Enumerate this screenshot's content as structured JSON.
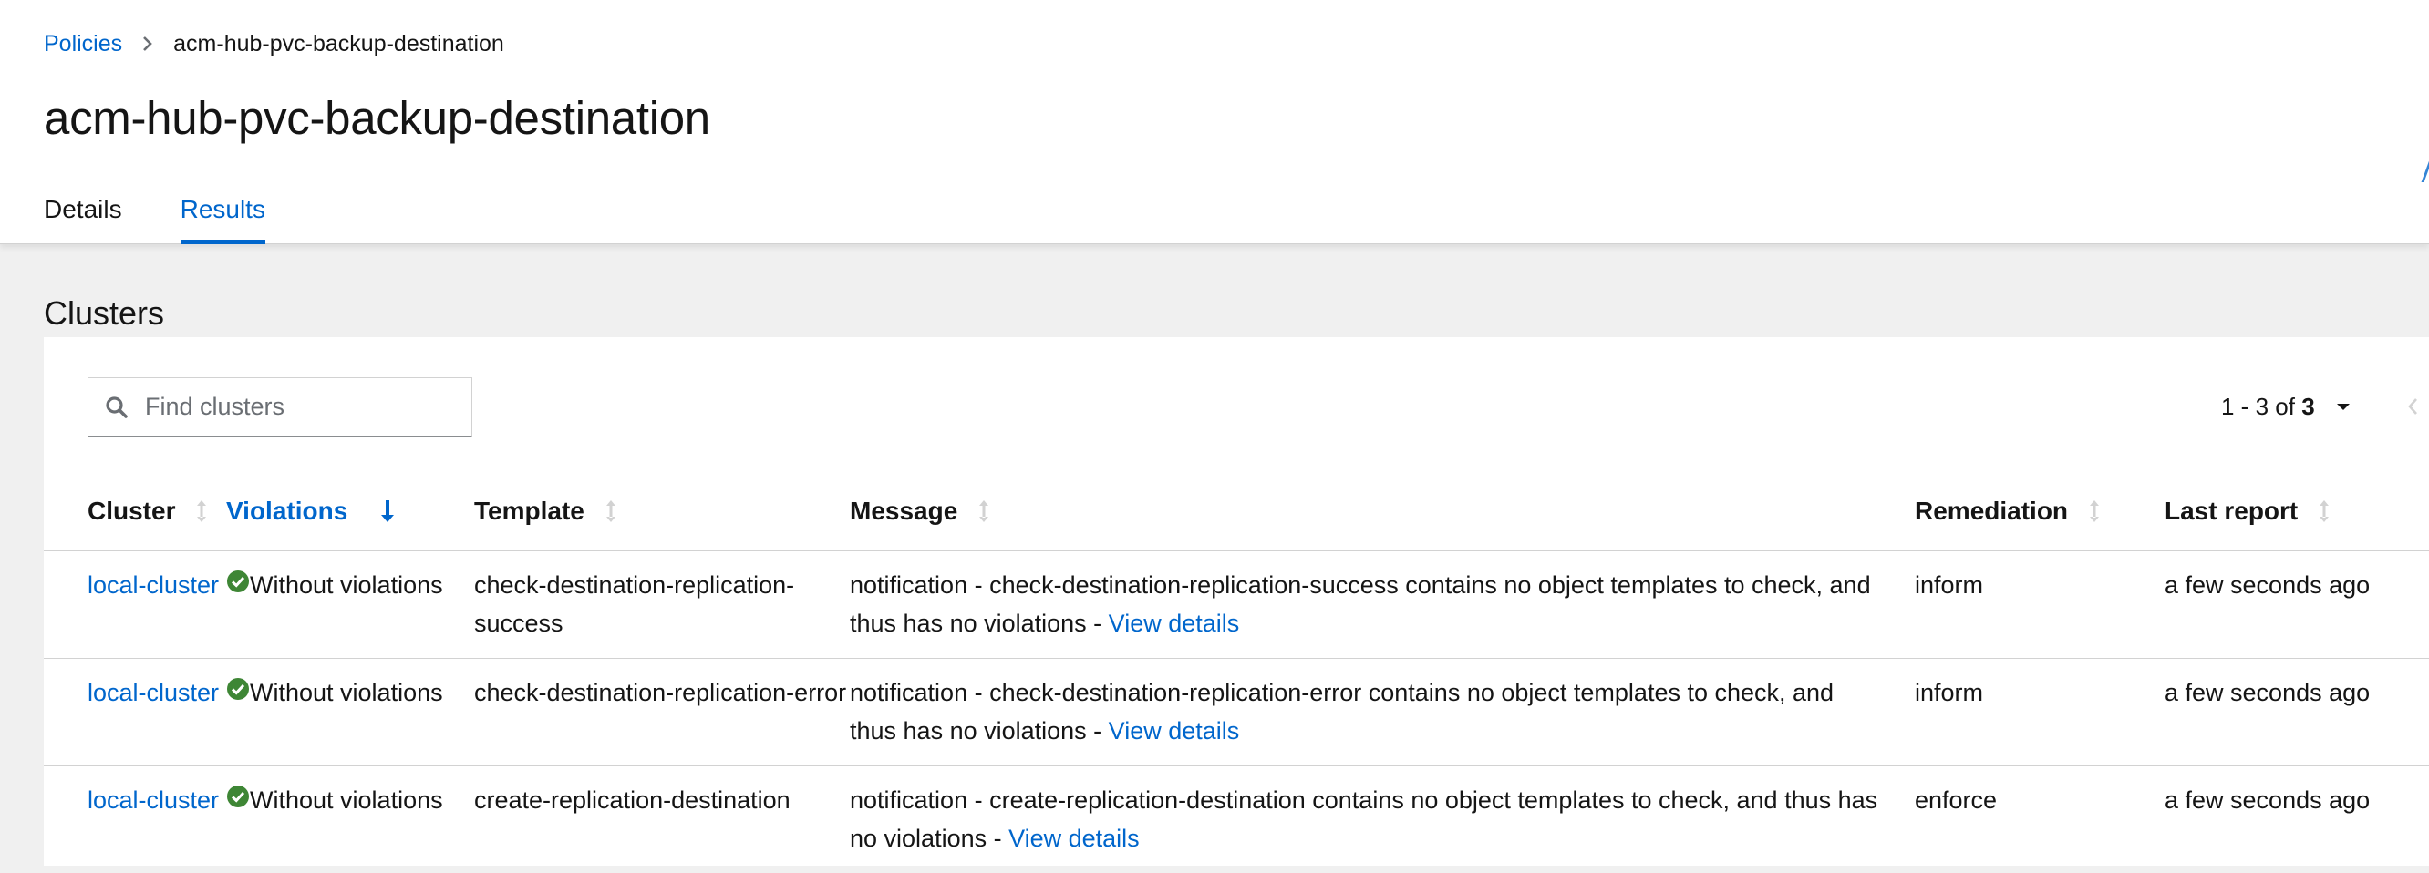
{
  "breadcrumb": {
    "parent": "Policies",
    "current": "acm-hub-pvc-backup-destination"
  },
  "title": "acm-hub-pvc-backup-destination",
  "tabs": [
    {
      "label": "Details",
      "active": false
    },
    {
      "label": "Results",
      "active": true
    }
  ],
  "section_title": "Clusters",
  "search": {
    "placeholder": "Find clusters",
    "value": ""
  },
  "pagination": {
    "range": "1 - 3",
    "of_label": "of",
    "total": "3"
  },
  "columns": {
    "cluster": "Cluster",
    "violations": "Violations",
    "template": "Template",
    "message": "Message",
    "remediation": "Remediation",
    "last_report": "Last report"
  },
  "rows": [
    {
      "cluster": "local-cluster",
      "status": "Without violations",
      "template": "check-destination-replication-success",
      "message": "notification - check-destination-replication-success contains no object templates to check, and thus has no violations - ",
      "link": "View details",
      "remediation": "inform",
      "last_report": "a few seconds ago"
    },
    {
      "cluster": "local-cluster",
      "status": "Without violations",
      "template": "check-destination-replication-error",
      "message": "notification - check-destination-replication-error contains no object templates to check, and thus has no violations - ",
      "link": "View details",
      "remediation": "inform",
      "last_report": "a few seconds ago"
    },
    {
      "cluster": "local-cluster",
      "status": "Without violations",
      "template": "create-replication-destination",
      "message": "notification - create-replication-destination contains no object templates to check, and thus has no violations - ",
      "link": "View details",
      "remediation": "enforce",
      "last_report": "a few seconds ago"
    }
  ],
  "colors": {
    "link": "#0066cc",
    "success": "#3e8635",
    "background": "#f0f0f0"
  },
  "icons": {
    "breadcrumb_separator": "chevron-right-icon",
    "search": "search-icon",
    "pagination_toggle": "caret-down-icon",
    "sort": "sort-icon",
    "sorted_desc": "long-arrow-down-icon",
    "status": "check-circle-icon",
    "previous": "angle-left-icon"
  }
}
